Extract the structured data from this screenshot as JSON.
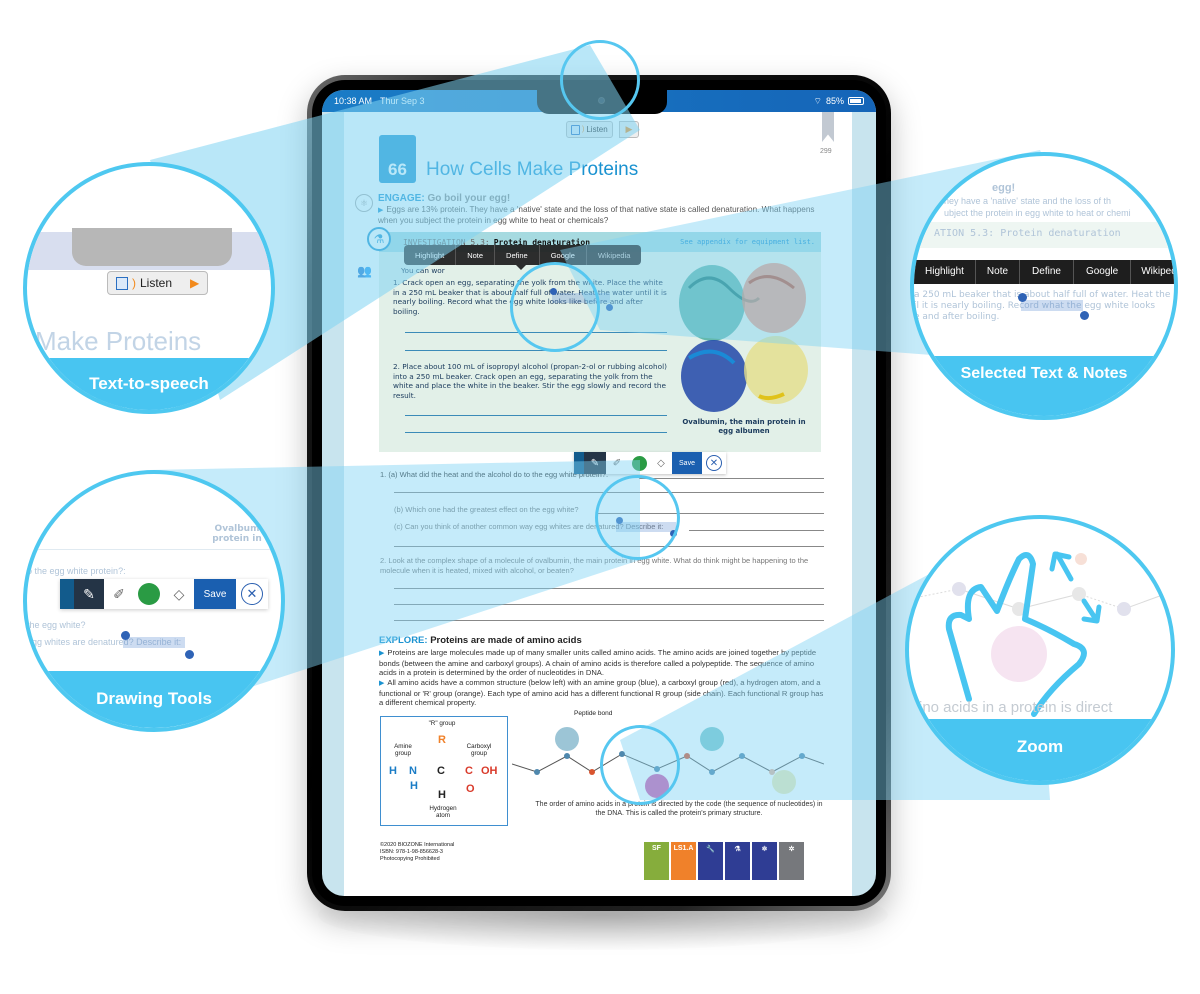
{
  "status_bar": {
    "time": "10:38 AM",
    "date": "Thur Sep 3",
    "battery": "85%",
    "wifi_icon": "wifi-icon"
  },
  "listen": {
    "label": "Listen",
    "play_icon": "play-icon"
  },
  "page_number": "299",
  "chapter": {
    "number": "66",
    "title": "How Cells Make Proteins"
  },
  "engage": {
    "keyword": "ENGAGE:",
    "heading": "Go boil your egg!",
    "text": "Eggs are 13% protein. They have a 'native' state and the loss of that native state is called denaturation. What happens when you subject the protein in egg white to heat or chemicals?"
  },
  "investigation": {
    "label": "INVESTIGATION 5.3:",
    "title": "Protein denaturation",
    "appendix": "See appendix for equipment list.",
    "intro": "You can wor",
    "steps": [
      "1.  Crack open an egg, separating the yolk from the white. Place the white in a 250 mL beaker that is about half full of water. Heat the water until it is nearly boiling. Record what the egg white looks like before and after boiling.",
      "2.  Place about 100 mL of isopropyl alcohol (propan-2-ol or rubbing alcohol) into a 250 mL beaker. Crack open an egg, separating the yolk from the white and place the white in the beaker. Stir the egg slowly and record the result."
    ],
    "image_caption": "Ovalbumin, the main protein in egg albumen"
  },
  "selection_menu": [
    "Highlight",
    "Note",
    "Define",
    "Google",
    "Wikipedia"
  ],
  "questions": {
    "q1a": "1.  (a) What did the heat and the alcohol do to the egg white protein?:",
    "q1b": "(b) Which one had the greatest effect on the egg white?",
    "q1c": "(c) Can you think of another common way egg whites are denatured? Describe it:",
    "q2": "2.  Look at the complex shape of a molecule of ovalbumin, the main protein in egg white. What do think might be happening to the molecule when it is heated, mixed with alcohol, or beaten?"
  },
  "drawing_toolbar": {
    "save_label": "Save",
    "active_color": "#2a9b44"
  },
  "explore": {
    "keyword": "EXPLORE:",
    "heading": "Proteins are made of amino acids",
    "p1": "Proteins are large molecules made up of many smaller units called amino acids. The amino acids are joined together by peptide bonds (between the amine and carboxyl groups). A chain of amino acids is therefore called a polypeptide.  The sequence of amino acids in a protein is determined by the order of nucleotides in DNA.",
    "p2": "All amino acids have a common structure (below left) with an amine group (blue), a carboxyl group (red), a hydrogen atom, and a functional or 'R' group (orange). Each type of amino acid has a different functional R group (side chain). Each functional R group has a different chemical property."
  },
  "amino_diagram": {
    "r_group": "\"R\" group",
    "amine": "Amine group",
    "carboxyl": "Carboxyl group",
    "hydrogen": "Hydrogen atom",
    "formula_h": "H",
    "formula_n": "N",
    "formula_c": "C",
    "formula_r": "R",
    "formula_cooh_c": "C",
    "formula_oh": "OH",
    "formula_o": "O"
  },
  "chain": {
    "peptide_label": "Peptide bond",
    "caption": "The order of amino acids in a protein is directed by the code (the sequence of nucleotides) in the DNA. This is called the protein's primary structure."
  },
  "footer": {
    "line1": "©2020 BIOZONE International",
    "line2": "ISBN: 978-1-98-856628-3",
    "line3": "Photocopying Prohibited",
    "tags": [
      {
        "label": "SF",
        "color": "#86ad3c"
      },
      {
        "label": "LS1.A",
        "color": "#f0812a"
      },
      {
        "label": "",
        "icon": "wrench-icon",
        "color": "#2f3d94"
      },
      {
        "label": "",
        "icon": "flask-icon",
        "color": "#2f3d94"
      },
      {
        "label": "",
        "icon": "atom-icon",
        "color": "#2f3d94"
      },
      {
        "label": "",
        "icon": "network-icon",
        "color": "#76787c"
      }
    ]
  },
  "callouts": {
    "tts": {
      "label": "Text-to-speech",
      "ghost_title": "Make Proteins",
      "listen": "Listen"
    },
    "selected": {
      "label": "Selected Text & Notes",
      "ghost_head": "egg!",
      "ghost_line1": "hey have a 'native' state and the loss of th",
      "ghost_line2": "ubject the protein in egg white to heat or chemi",
      "ghost_invest": "ATION 5.3: Protein denaturation",
      "ghost_body1": "a 250 mL beaker that is about half full of water. Heat the",
      "ghost_body2": "il it is nearly boiling. Record what the egg white looks",
      "ghost_body3": "e and after boiling."
    },
    "drawing": {
      "label": "Drawing Tools",
      "save": "Save",
      "ghost1": "o the egg white protein?:",
      "ghost2": "the egg white?",
      "ghost3": "egg whites are denatured? Describe it:",
      "ghost_caption": "Ovalbum protein in"
    },
    "zoom": {
      "label": "Zoom",
      "ghost": "ino acids in a protein is direct"
    }
  }
}
